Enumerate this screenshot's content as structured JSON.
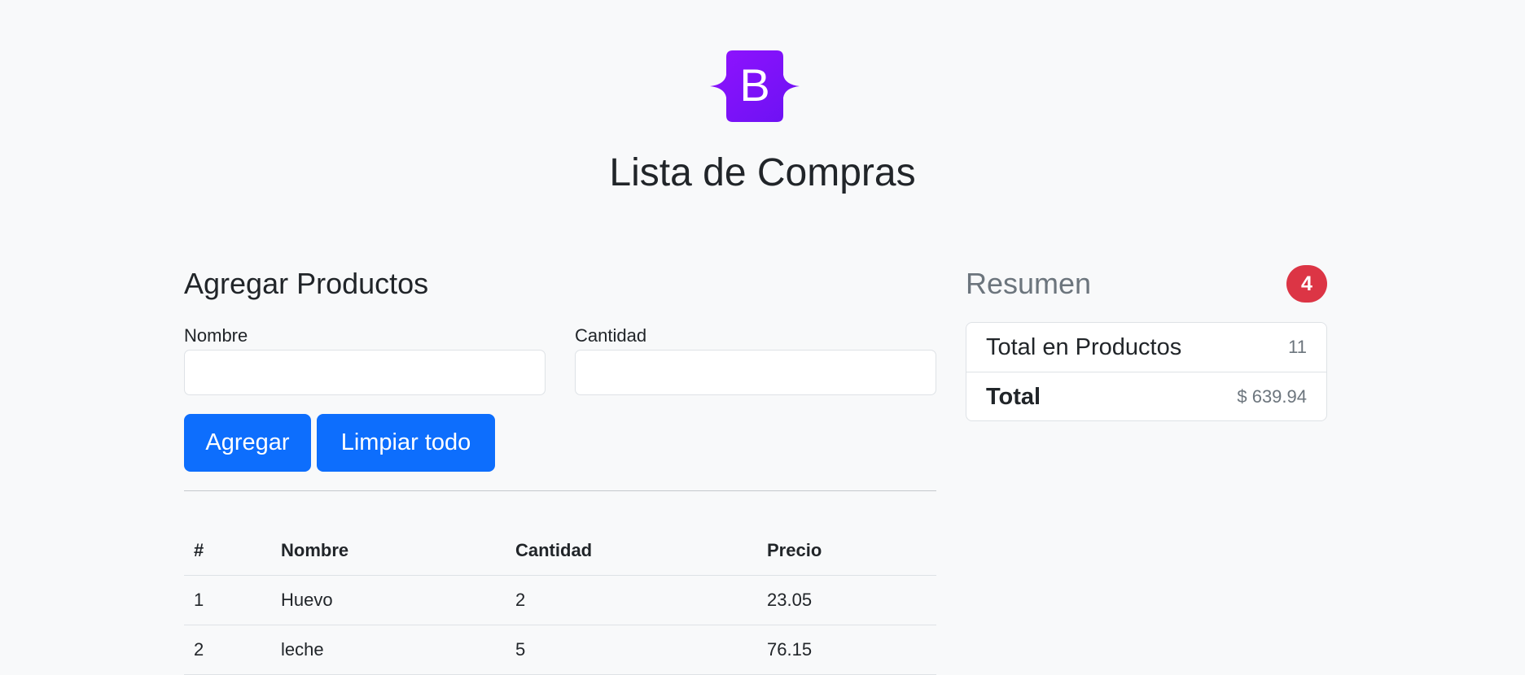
{
  "header": {
    "logo_letter": "B",
    "title": "Lista de Compras"
  },
  "form": {
    "section_title": "Agregar Productos",
    "name_label": "Nombre",
    "name_value": "",
    "quantity_label": "Cantidad",
    "quantity_value": "",
    "add_button": "Agregar",
    "clear_button": "Limpiar todo"
  },
  "table": {
    "columns": [
      "#",
      "Nombre",
      "Cantidad",
      "Precio"
    ],
    "rows": [
      [
        "1",
        "Huevo",
        "2",
        "23.05"
      ],
      [
        "2",
        "leche",
        "5",
        "76.15"
      ]
    ]
  },
  "summary": {
    "title": "Resumen",
    "badge_count": "4",
    "items": [
      {
        "label": "Total en Productos",
        "value": "11"
      },
      {
        "label": "Total",
        "value": "$ 639.94"
      }
    ]
  },
  "colors": {
    "primary": "#0d6efd",
    "danger": "#dc3545",
    "logo_purple": "#7c1cf5",
    "background": "#f8f9fa"
  }
}
